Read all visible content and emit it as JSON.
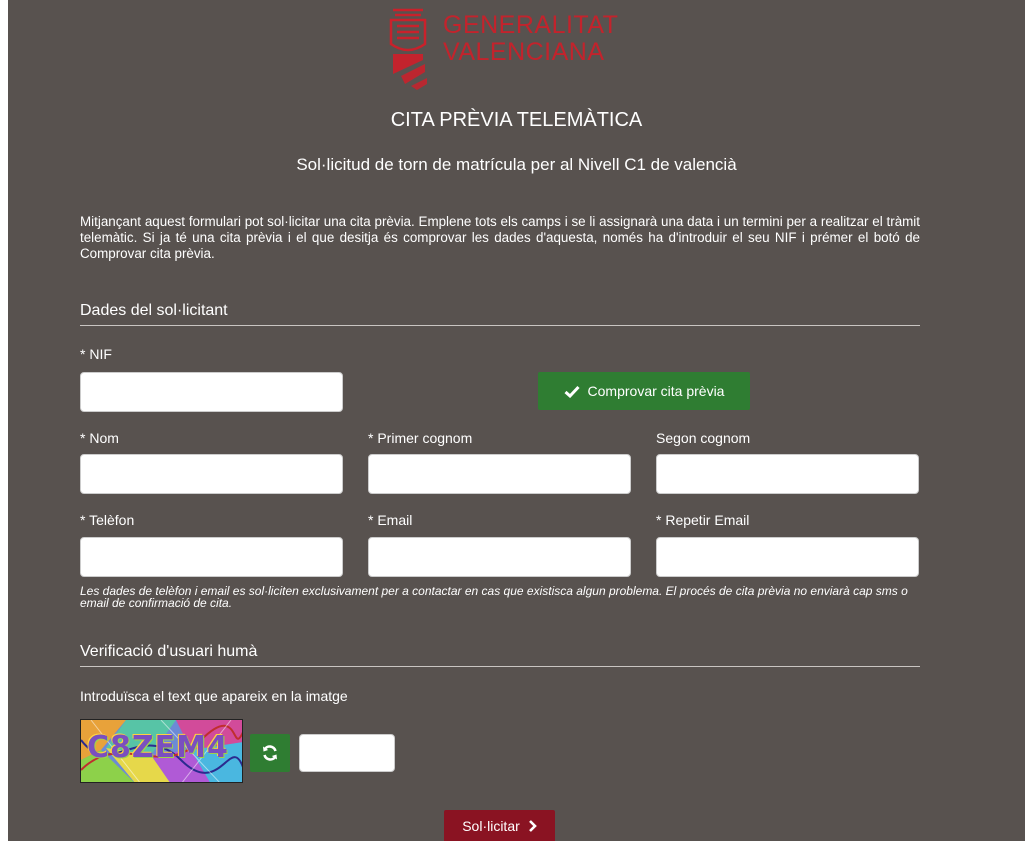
{
  "header": {
    "logo_line1": "GENERALITAT",
    "logo_line2": "VALENCIANA",
    "title": "CITA PRÈVIA TELEMÀTICA",
    "subtitle": "Sol·licitud de torn de matrícula per al Nivell C1 de valencià"
  },
  "intro": "Mitjançant aquest formulari pot sol·licitar una cita prèvia. Emplene tots els camps i se li assignarà una data i un termini per a realitzar el tràmit telemàtic. Si ja té una cita prèvia i el que desitja és comprovar les dades d'aquesta, només ha d'introduir el seu NIF i prémer el botó de Comprovar cita prèvia.",
  "applicant_section": {
    "heading": "Dades del sol·licitant",
    "nif_label": "* NIF",
    "nif_value": "",
    "check_button": "Comprovar cita prèvia",
    "nom_label": "* Nom",
    "nom_value": "",
    "primer_cognom_label": "* Primer cognom",
    "primer_cognom_value": "",
    "segon_cognom_label": "Segon cognom",
    "segon_cognom_value": "",
    "telefon_label": "* Telèfon",
    "telefon_value": "",
    "email_label": "* Email",
    "email_value": "",
    "repetir_email_label": "* Repetir Email",
    "repetir_email_value": "",
    "note": "Les dades de telèfon i email es sol·liciten exclusivament per a contactar en cas que existisca algun problema. El procés de cita prèvia no enviarà cap sms o email de confirmació de cita."
  },
  "verification_section": {
    "heading": "Verificació d'usuari humà",
    "instruction": "Introduïsca el text que apareix en la imatge",
    "captcha_text": "C8ZEM4",
    "captcha_value": ""
  },
  "submit_button": "Sol·licitar",
  "colors": {
    "background": "#58524f",
    "brand_red": "#c9212b",
    "green_button": "#2f7d32",
    "submit_button": "#8a1322"
  },
  "icons": {
    "check": "check-icon",
    "refresh": "refresh-icon",
    "chevron": "chevron-right-icon"
  }
}
